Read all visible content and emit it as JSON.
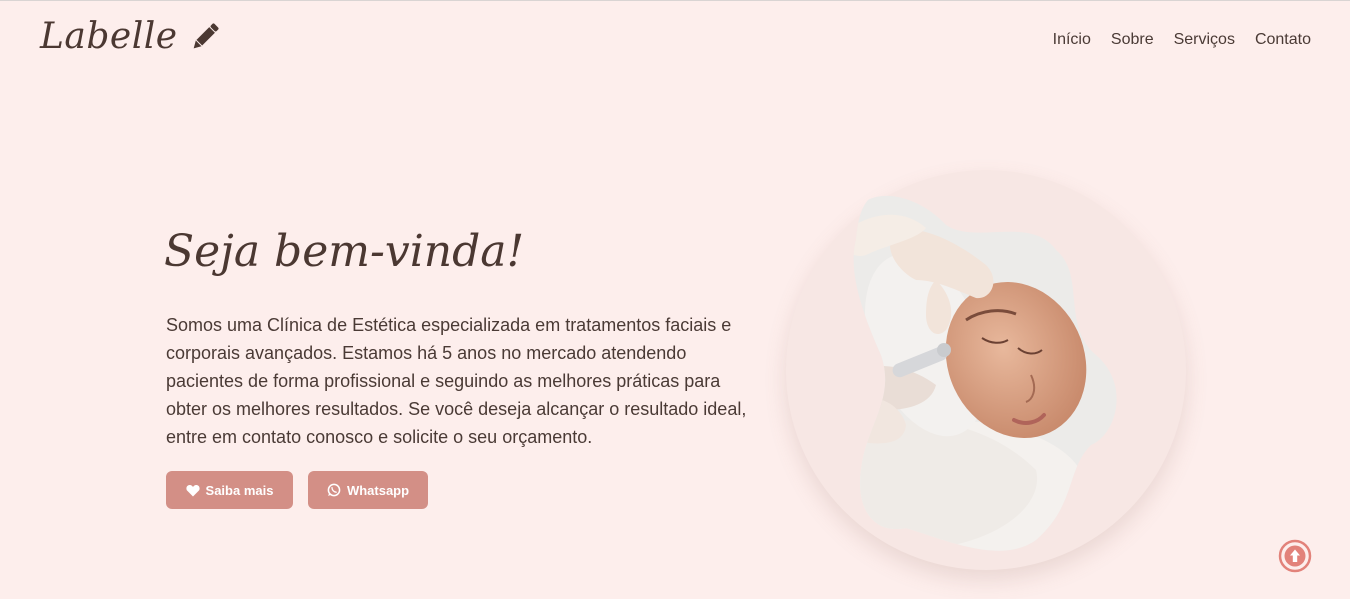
{
  "header": {
    "logo_text": "Labelle",
    "nav": [
      "Início",
      "Sobre",
      "Serviços",
      "Contato"
    ]
  },
  "hero": {
    "title": "Seja bem-vinda!",
    "description": "Somos uma Clínica de Estética especializada em tratamentos faciais e corporais avançados. Estamos há 5 anos no mercado atendendo pacientes de forma profissional e seguindo as melhores práticas para obter os melhores resultados. Se você deseja alcançar o resultado ideal, entre em contato conosco e solicite o seu orçamento.",
    "buttons": {
      "saiba_label": "Saiba mais",
      "whatsapp_label": "Whatsapp"
    }
  },
  "colors": {
    "background": "#fdeeec",
    "accent": "#d38f86",
    "text_dark": "#4b3832",
    "scroll_icon": "#e2827a"
  },
  "icons": [
    "pencil-icon",
    "heart-icon",
    "whatsapp-icon",
    "arrow-up-circle-icon"
  ]
}
